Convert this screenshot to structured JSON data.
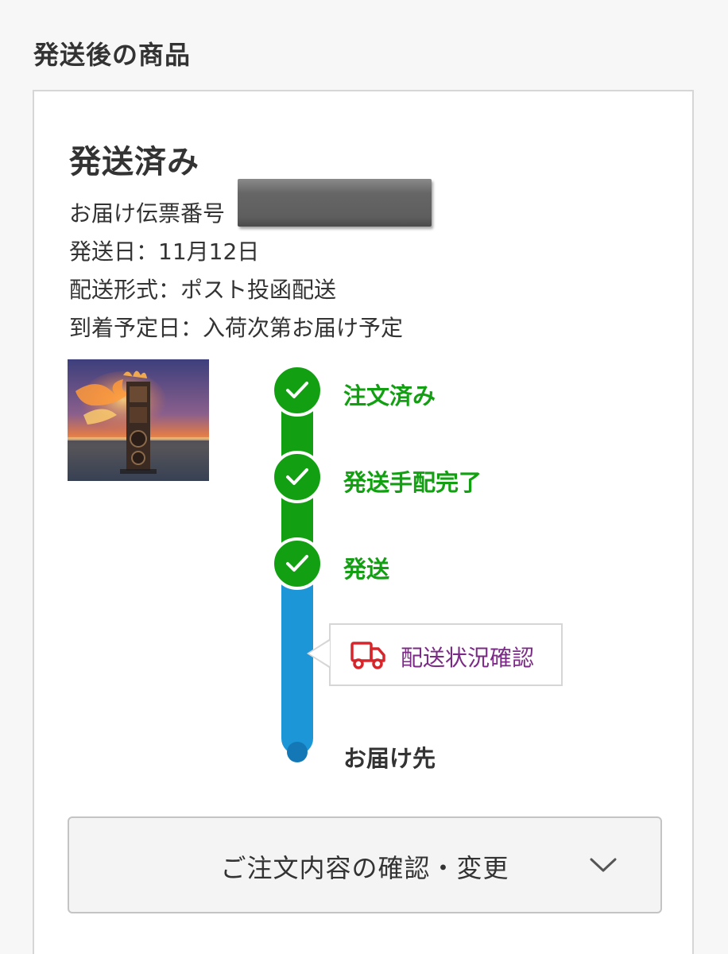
{
  "section": {
    "title": "発送後の商品"
  },
  "shipment": {
    "status": "発送済み",
    "tracking_label": "お届け伝票番号",
    "ship_date": "発送日：11月12日",
    "method": "配送形式：ポスト投函配送",
    "eta": "到着予定日：入荷次第お届け予定"
  },
  "timeline": {
    "steps": [
      {
        "label": "注文済み"
      },
      {
        "label": "発送手配完了"
      },
      {
        "label": "発送"
      }
    ],
    "tracking_link": "配送状況確認",
    "destination": "お届け先"
  },
  "order_button": {
    "label": "ご注文内容の確認・変更"
  },
  "colors": {
    "done_green": "#12a012",
    "progress_blue": "#1d96d8",
    "link_purple": "#7b2a86",
    "truck_red": "#d7262b"
  },
  "icons": {
    "step": "check-icon",
    "tracking": "truck-icon",
    "expand": "chevron-down-icon"
  }
}
